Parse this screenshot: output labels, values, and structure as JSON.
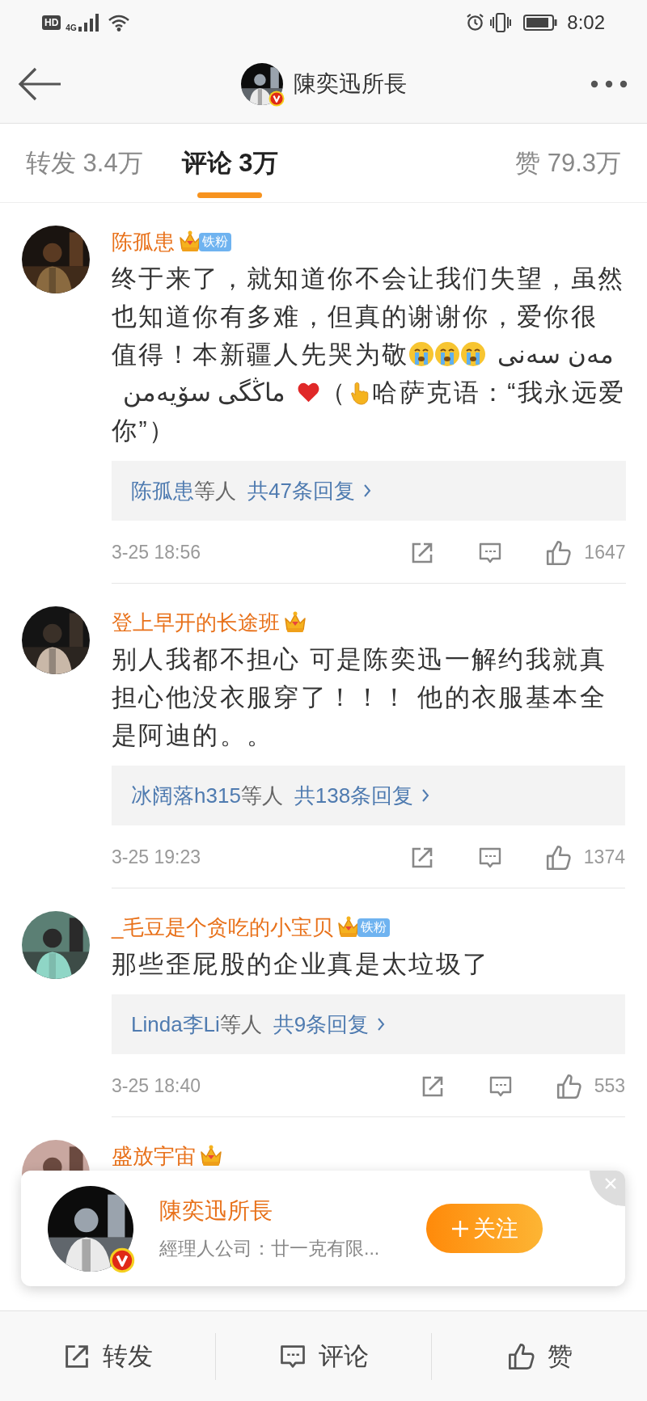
{
  "status_bar": {
    "hd_badge": "HD",
    "network": "4G",
    "time": "8:02"
  },
  "header": {
    "title": "陳奕迅所長",
    "verified": true
  },
  "tabs": [
    {
      "label": "转发",
      "count": "3.4万",
      "selected": false
    },
    {
      "label": "评论",
      "count": "3万",
      "selected": true
    },
    {
      "label": "赞",
      "count": "79.3万",
      "selected": false
    }
  ],
  "comments": [
    {
      "user": "陈孤患",
      "crown": true,
      "badge": "铁粉",
      "lines": [
        [
          {
            "kind": "text",
            "text": "终于来了，就知道你不会让我们失望，虽然"
          }
        ],
        [
          {
            "kind": "text",
            "text": "也知道你有多难，但真的谢谢你，爱你很"
          }
        ],
        [
          {
            "kind": "text",
            "text": "值得！本新疆人先哭为敬"
          },
          {
            "kind": "crying_emoji"
          },
          {
            "kind": "crying_emoji"
          },
          {
            "kind": "crying_emoji"
          },
          {
            "kind": "text",
            "text": "مەن سەنى"
          }
        ],
        [
          {
            "kind": "text",
            "text": "ماڭگى سۆيەمن"
          },
          {
            "kind": "heart_emoji"
          },
          {
            "kind": "text",
            "text": "（"
          },
          {
            "kind": "pointing_emoji"
          },
          {
            "kind": "text",
            "text": "哈萨克语：“我永远爱"
          }
        ],
        [
          {
            "kind": "text",
            "text": "你”）"
          }
        ]
      ],
      "reply_users": "陈孤患",
      "reply_suffix": "等人",
      "reply_count": "共47条回复",
      "time": "3-25 18:56",
      "likes": "1647"
    },
    {
      "user": "登上早开的长途班",
      "crown": true,
      "text": "别人我都不担心 可是陈奕迅一解约我就真担心他没衣服穿了！！！ 他的衣服基本全是阿迪的。。",
      "reply_users": "冰阔落h315",
      "reply_suffix": "等人",
      "reply_count": "共138条回复",
      "time": "3-25 19:23",
      "likes": "1374"
    },
    {
      "user": "_毛豆是个贪吃的小宝贝",
      "crown": true,
      "badge": "铁粉",
      "text": "那些歪屁股的企业真是太垃圾了",
      "reply_users": "Linda李Li",
      "reply_suffix": "等人",
      "reply_count": "共9条回复",
      "time": "3-25 18:40",
      "likes": "553"
    },
    {
      "user": "盛放宇宙",
      "crown": true
    }
  ],
  "popup": {
    "name": "陳奕迅所長",
    "verified": true,
    "subtitle": "經理人公司：廿一克有限...",
    "follow_label": "关注"
  },
  "bottom_bar": [
    {
      "label": "转发",
      "kind": "repost"
    },
    {
      "label": "评论",
      "kind": "comment"
    },
    {
      "label": "赞",
      "kind": "like"
    }
  ]
}
